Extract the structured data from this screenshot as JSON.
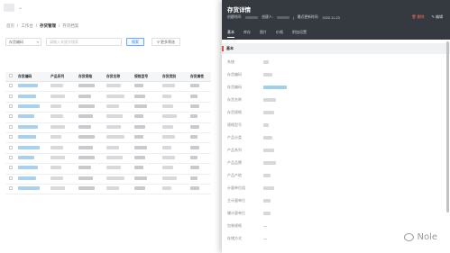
{
  "list_page": {
    "breadcrumb": [
      "首页",
      "工作台",
      "存货管理",
      "存货档案"
    ],
    "filter": {
      "select_value": "存货编码",
      "search_placeholder": "请输入关键字搜索",
      "search_label": "搜索",
      "advanced_label": "更多筛选"
    },
    "columns": [
      "存货编码",
      "产品系列",
      "存货规格",
      "存货名称",
      "规格型号",
      "存货类别",
      "存货属性"
    ]
  },
  "drawer": {
    "title": "存货详情",
    "meta": {
      "created_label": "创建时间:",
      "creator_label": "创建人:",
      "modified_label": "最近更新时间:",
      "modified_value": "2020-11-23"
    },
    "actions": {
      "delete": "删除",
      "edit": "编辑"
    },
    "tabs": [
      "基本",
      "库存",
      "图片",
      "价格",
      "附加设置"
    ],
    "section_title": "基本",
    "fields": [
      {
        "label": "系统",
        "val": "",
        "w": 6
      },
      {
        "label": "存货编码",
        "val": "",
        "w": 10
      },
      {
        "label": "存货编码",
        "val": "",
        "w": 26,
        "link": true
      },
      {
        "label": "存货名称",
        "val": "",
        "w": 14
      },
      {
        "label": "存货规格",
        "val": "",
        "w": 12
      },
      {
        "label": "规格型号",
        "val": "",
        "w": 6
      },
      {
        "label": "产品分类",
        "val": "",
        "w": 10
      },
      {
        "label": "产品系列",
        "val": "",
        "w": 12
      },
      {
        "label": "产品品牌",
        "val": "",
        "w": 14
      },
      {
        "label": "产品产地",
        "val": "",
        "w": 8
      },
      {
        "label": "计量单位组",
        "val": "",
        "w": 12
      },
      {
        "label": "主计量单位",
        "val": "",
        "w": 8
      },
      {
        "label": "辅计量单位",
        "val": "",
        "w": 8
      },
      {
        "label": "包装规格",
        "val": "—",
        "w": 0
      },
      {
        "label": "存储方式",
        "val": "—",
        "w": 0
      }
    ]
  },
  "watermark": "Nole"
}
